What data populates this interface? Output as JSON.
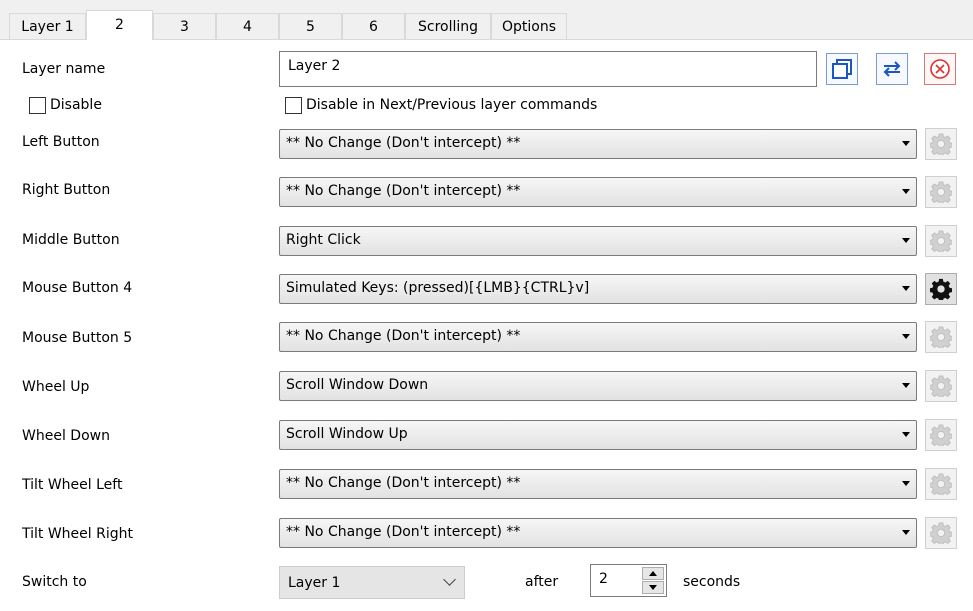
{
  "tabs": [
    "Layer 1",
    "2",
    "3",
    "4",
    "5",
    "6",
    "Scrolling",
    "Options"
  ],
  "layer_name_label": "Layer name",
  "layer_name_value": "Layer 2",
  "disable_label": "Disable",
  "disable_next_prev_label": "Disable in Next/Previous layer commands",
  "buttons": [
    {
      "label": "Left Button",
      "value": "** No Change (Don't intercept) **",
      "gear_enabled": false
    },
    {
      "label": "Right Button",
      "value": "** No Change (Don't intercept) **",
      "gear_enabled": false
    },
    {
      "label": "Middle Button",
      "value": "Right Click",
      "gear_enabled": false
    },
    {
      "label": "Mouse Button 4",
      "value": "Simulated Keys: (pressed)[{LMB}{CTRL}v]",
      "gear_enabled": true
    },
    {
      "label": "Mouse Button 5",
      "value": "** No Change (Don't intercept) **",
      "gear_enabled": false
    },
    {
      "label": "Wheel Up",
      "value": "Scroll Window Down",
      "gear_enabled": false
    },
    {
      "label": "Wheel Down",
      "value": "Scroll Window Up",
      "gear_enabled": false
    },
    {
      "label": "Tilt Wheel Left",
      "value": "** No Change (Don't intercept) **",
      "gear_enabled": false
    },
    {
      "label": "Tilt Wheel Right",
      "value": "** No Change (Don't intercept) **",
      "gear_enabled": false
    }
  ],
  "switch_to_label": "Switch to",
  "switch_to_value": "Layer 1",
  "after_label": "after",
  "after_value": "2",
  "seconds_label": "seconds"
}
